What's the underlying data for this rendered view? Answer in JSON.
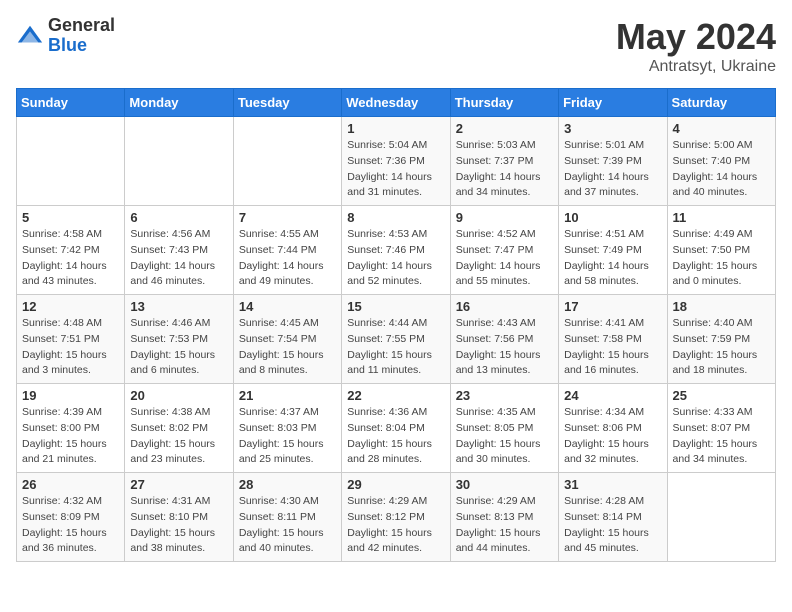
{
  "header": {
    "logo_general": "General",
    "logo_blue": "Blue",
    "title": "May 2024",
    "location": "Antratsyt, Ukraine"
  },
  "days_of_week": [
    "Sunday",
    "Monday",
    "Tuesday",
    "Wednesday",
    "Thursday",
    "Friday",
    "Saturday"
  ],
  "weeks": [
    [
      {
        "day": "",
        "info": ""
      },
      {
        "day": "",
        "info": ""
      },
      {
        "day": "",
        "info": ""
      },
      {
        "day": "1",
        "info": "Sunrise: 5:04 AM\nSunset: 7:36 PM\nDaylight: 14 hours\nand 31 minutes."
      },
      {
        "day": "2",
        "info": "Sunrise: 5:03 AM\nSunset: 7:37 PM\nDaylight: 14 hours\nand 34 minutes."
      },
      {
        "day": "3",
        "info": "Sunrise: 5:01 AM\nSunset: 7:39 PM\nDaylight: 14 hours\nand 37 minutes."
      },
      {
        "day": "4",
        "info": "Sunrise: 5:00 AM\nSunset: 7:40 PM\nDaylight: 14 hours\nand 40 minutes."
      }
    ],
    [
      {
        "day": "5",
        "info": "Sunrise: 4:58 AM\nSunset: 7:42 PM\nDaylight: 14 hours\nand 43 minutes."
      },
      {
        "day": "6",
        "info": "Sunrise: 4:56 AM\nSunset: 7:43 PM\nDaylight: 14 hours\nand 46 minutes."
      },
      {
        "day": "7",
        "info": "Sunrise: 4:55 AM\nSunset: 7:44 PM\nDaylight: 14 hours\nand 49 minutes."
      },
      {
        "day": "8",
        "info": "Sunrise: 4:53 AM\nSunset: 7:46 PM\nDaylight: 14 hours\nand 52 minutes."
      },
      {
        "day": "9",
        "info": "Sunrise: 4:52 AM\nSunset: 7:47 PM\nDaylight: 14 hours\nand 55 minutes."
      },
      {
        "day": "10",
        "info": "Sunrise: 4:51 AM\nSunset: 7:49 PM\nDaylight: 14 hours\nand 58 minutes."
      },
      {
        "day": "11",
        "info": "Sunrise: 4:49 AM\nSunset: 7:50 PM\nDaylight: 15 hours\nand 0 minutes."
      }
    ],
    [
      {
        "day": "12",
        "info": "Sunrise: 4:48 AM\nSunset: 7:51 PM\nDaylight: 15 hours\nand 3 minutes."
      },
      {
        "day": "13",
        "info": "Sunrise: 4:46 AM\nSunset: 7:53 PM\nDaylight: 15 hours\nand 6 minutes."
      },
      {
        "day": "14",
        "info": "Sunrise: 4:45 AM\nSunset: 7:54 PM\nDaylight: 15 hours\nand 8 minutes."
      },
      {
        "day": "15",
        "info": "Sunrise: 4:44 AM\nSunset: 7:55 PM\nDaylight: 15 hours\nand 11 minutes."
      },
      {
        "day": "16",
        "info": "Sunrise: 4:43 AM\nSunset: 7:56 PM\nDaylight: 15 hours\nand 13 minutes."
      },
      {
        "day": "17",
        "info": "Sunrise: 4:41 AM\nSunset: 7:58 PM\nDaylight: 15 hours\nand 16 minutes."
      },
      {
        "day": "18",
        "info": "Sunrise: 4:40 AM\nSunset: 7:59 PM\nDaylight: 15 hours\nand 18 minutes."
      }
    ],
    [
      {
        "day": "19",
        "info": "Sunrise: 4:39 AM\nSunset: 8:00 PM\nDaylight: 15 hours\nand 21 minutes."
      },
      {
        "day": "20",
        "info": "Sunrise: 4:38 AM\nSunset: 8:02 PM\nDaylight: 15 hours\nand 23 minutes."
      },
      {
        "day": "21",
        "info": "Sunrise: 4:37 AM\nSunset: 8:03 PM\nDaylight: 15 hours\nand 25 minutes."
      },
      {
        "day": "22",
        "info": "Sunrise: 4:36 AM\nSunset: 8:04 PM\nDaylight: 15 hours\nand 28 minutes."
      },
      {
        "day": "23",
        "info": "Sunrise: 4:35 AM\nSunset: 8:05 PM\nDaylight: 15 hours\nand 30 minutes."
      },
      {
        "day": "24",
        "info": "Sunrise: 4:34 AM\nSunset: 8:06 PM\nDaylight: 15 hours\nand 32 minutes."
      },
      {
        "day": "25",
        "info": "Sunrise: 4:33 AM\nSunset: 8:07 PM\nDaylight: 15 hours\nand 34 minutes."
      }
    ],
    [
      {
        "day": "26",
        "info": "Sunrise: 4:32 AM\nSunset: 8:09 PM\nDaylight: 15 hours\nand 36 minutes."
      },
      {
        "day": "27",
        "info": "Sunrise: 4:31 AM\nSunset: 8:10 PM\nDaylight: 15 hours\nand 38 minutes."
      },
      {
        "day": "28",
        "info": "Sunrise: 4:30 AM\nSunset: 8:11 PM\nDaylight: 15 hours\nand 40 minutes."
      },
      {
        "day": "29",
        "info": "Sunrise: 4:29 AM\nSunset: 8:12 PM\nDaylight: 15 hours\nand 42 minutes."
      },
      {
        "day": "30",
        "info": "Sunrise: 4:29 AM\nSunset: 8:13 PM\nDaylight: 15 hours\nand 44 minutes."
      },
      {
        "day": "31",
        "info": "Sunrise: 4:28 AM\nSunset: 8:14 PM\nDaylight: 15 hours\nand 45 minutes."
      },
      {
        "day": "",
        "info": ""
      }
    ]
  ]
}
